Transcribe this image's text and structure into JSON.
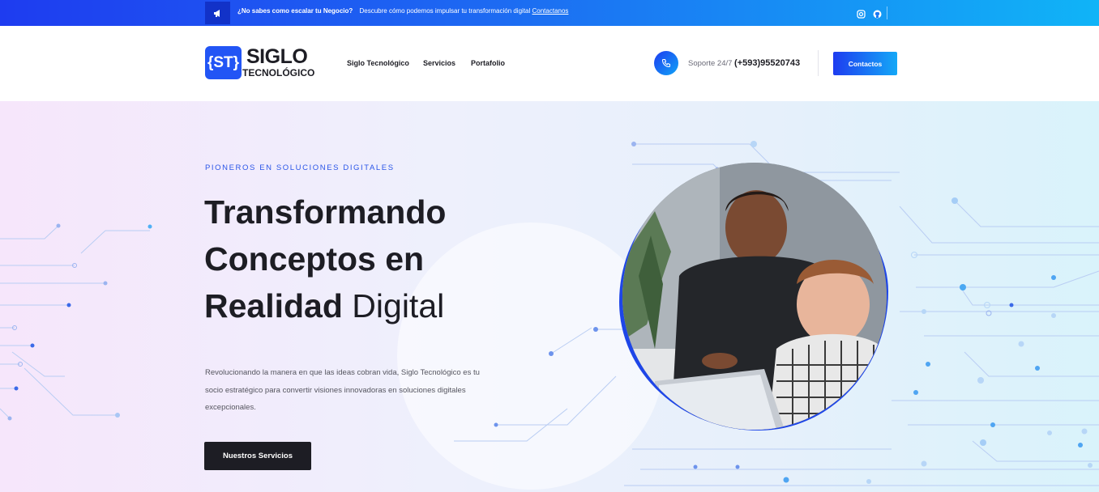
{
  "topbar": {
    "question": "¿No sabes como escalar tu Negocio?",
    "message": "Descubre cómo podemos impulsar tu transformación digital",
    "link": "Contactanos",
    "icons": [
      "megaphone-icon",
      "instagram-icon",
      "github-icon"
    ]
  },
  "header": {
    "logo_mark": "{ST}",
    "logo_title": "SIGLO",
    "logo_subtitle": "TECNOLÓGICO",
    "nav": [
      "Siglo Tecnológico",
      "Servicios",
      "Portafolio"
    ],
    "support_label": "Soporte 24/7",
    "support_phone": "(+593)95520743",
    "contact_button": "Contactos"
  },
  "hero": {
    "kicker": "PIONEROS EN SOLUCIONES DIGITALES",
    "title_line1": "Transformando",
    "title_line2": "Conceptos en",
    "title_line3_bold": "Realidad",
    "title_line3_light": "Digital",
    "description": "Revolucionando la manera en que las ideas cobran vida, Siglo Tecnológico es tu socio estratégico para convertir visiones innovadoras en soluciones digitales excepcionales.",
    "cta": "Nuestros Servicios"
  },
  "colors": {
    "brand_blue": "#2255f5",
    "gradient_start": "#1e3cf0",
    "gradient_end": "#10b4f7",
    "dark": "#1d1d24"
  }
}
